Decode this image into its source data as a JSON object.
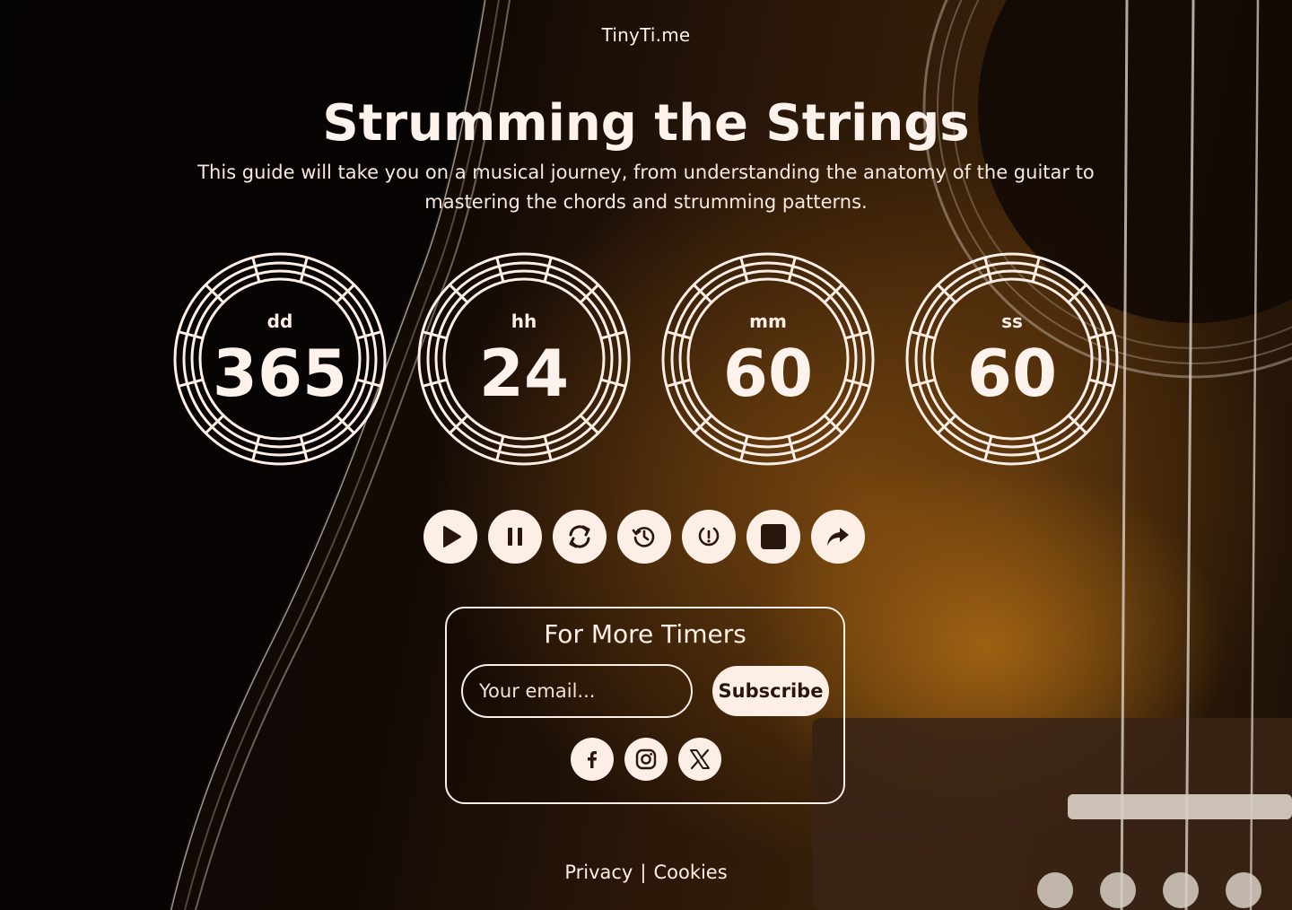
{
  "brand": "TinyTi.me",
  "hero": {
    "title": "Strumming the Strings",
    "subtitle": "This guide will take you on a musical journey, from understanding the anatomy of the guitar to mastering the chords and strumming patterns."
  },
  "timer": {
    "units": [
      {
        "label": "dd",
        "value": "365"
      },
      {
        "label": "hh",
        "value": "24"
      },
      {
        "label": "mm",
        "value": "60"
      },
      {
        "label": "ss",
        "value": "60"
      }
    ]
  },
  "controls": [
    {
      "name": "play-button",
      "icon": "play-icon"
    },
    {
      "name": "pause-button",
      "icon": "pause-icon"
    },
    {
      "name": "reload-button",
      "icon": "refresh-icon"
    },
    {
      "name": "history-button",
      "icon": "history-icon"
    },
    {
      "name": "timer-reset-button",
      "icon": "clock-reset-icon"
    },
    {
      "name": "stop-button",
      "icon": "stop-icon"
    },
    {
      "name": "share-button",
      "icon": "share-icon"
    }
  ],
  "subscribe": {
    "title": "For More Timers",
    "email_placeholder": "Your email...",
    "button_label": "Subscribe"
  },
  "socials": [
    {
      "name": "facebook",
      "icon": "facebook-icon"
    },
    {
      "name": "instagram",
      "icon": "instagram-icon"
    },
    {
      "name": "x",
      "icon": "x-icon"
    }
  ],
  "footer": {
    "privacy": "Privacy",
    "separator": "|",
    "cookies": "Cookies"
  },
  "colors": {
    "accent": "#fdeee6",
    "icon_dark": "#2a170b"
  }
}
